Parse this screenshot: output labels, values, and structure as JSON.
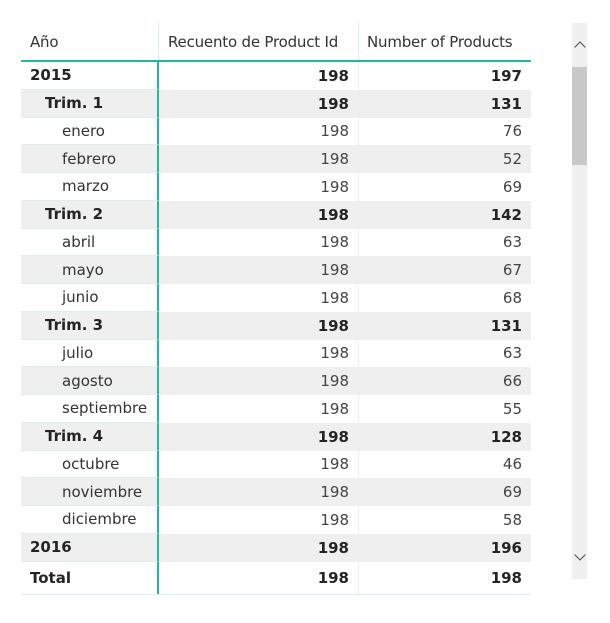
{
  "table": {
    "headers": [
      "Año",
      "Recuento de Product Id",
      "Number of Products"
    ],
    "rows": [
      {
        "label": "2015",
        "level": 0,
        "bold": true,
        "count": "198",
        "products": "197"
      },
      {
        "label": "Trim. 1",
        "level": 1,
        "bold": true,
        "count": "198",
        "products": "131"
      },
      {
        "label": "enero",
        "level": 2,
        "bold": false,
        "count": "198",
        "products": "76"
      },
      {
        "label": "febrero",
        "level": 2,
        "bold": false,
        "count": "198",
        "products": "52"
      },
      {
        "label": "marzo",
        "level": 2,
        "bold": false,
        "count": "198",
        "products": "69"
      },
      {
        "label": "Trim. 2",
        "level": 1,
        "bold": true,
        "count": "198",
        "products": "142"
      },
      {
        "label": "abril",
        "level": 2,
        "bold": false,
        "count": "198",
        "products": "63"
      },
      {
        "label": "mayo",
        "level": 2,
        "bold": false,
        "count": "198",
        "products": "67"
      },
      {
        "label": "junio",
        "level": 2,
        "bold": false,
        "count": "198",
        "products": "68"
      },
      {
        "label": "Trim. 3",
        "level": 1,
        "bold": true,
        "count": "198",
        "products": "131"
      },
      {
        "label": "julio",
        "level": 2,
        "bold": false,
        "count": "198",
        "products": "63"
      },
      {
        "label": "agosto",
        "level": 2,
        "bold": false,
        "count": "198",
        "products": "66"
      },
      {
        "label": "septiembre",
        "level": 2,
        "bold": false,
        "count": "198",
        "products": "55"
      },
      {
        "label": "Trim. 4",
        "level": 1,
        "bold": true,
        "count": "198",
        "products": "128"
      },
      {
        "label": "octubre",
        "level": 2,
        "bold": false,
        "count": "198",
        "products": "46"
      },
      {
        "label": "noviembre",
        "level": 2,
        "bold": false,
        "count": "198",
        "products": "69"
      },
      {
        "label": "diciembre",
        "level": 2,
        "bold": false,
        "count": "198",
        "products": "58"
      },
      {
        "label": "2016",
        "level": 0,
        "bold": true,
        "count": "198",
        "products": "196"
      }
    ],
    "total": {
      "label": "Total",
      "count": "198",
      "products": "198"
    }
  },
  "scrollbar": {
    "up_icon": "chevron-up-icon",
    "down_icon": "chevron-down-icon"
  },
  "colors": {
    "accent": "#1fb8a8",
    "alt_row": "#efefef",
    "scroll_track": "#f0f0f0",
    "scroll_thumb": "#c8c8c8"
  }
}
